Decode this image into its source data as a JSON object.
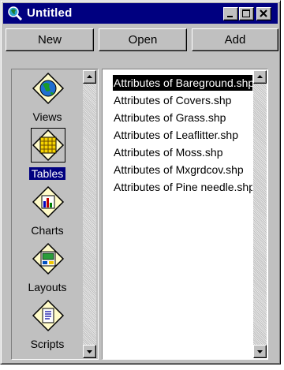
{
  "window": {
    "title": "Untitled"
  },
  "toolbar": {
    "new_label": "New",
    "open_label": "Open",
    "add_label": "Add"
  },
  "doc_types": [
    {
      "label": "Views",
      "icon": "globe-icon",
      "selected": false
    },
    {
      "label": "Tables",
      "icon": "table-grid-icon",
      "selected": true
    },
    {
      "label": "Charts",
      "icon": "bar-chart-icon",
      "selected": false
    },
    {
      "label": "Layouts",
      "icon": "layout-icon",
      "selected": false
    },
    {
      "label": "Scripts",
      "icon": "script-icon",
      "selected": false
    }
  ],
  "tables": [
    {
      "label": "Attributes of Bareground.shp",
      "selected": true
    },
    {
      "label": "Attributes of Covers.shp",
      "selected": false
    },
    {
      "label": "Attributes of Grass.shp",
      "selected": false
    },
    {
      "label": "Attributes of Leaflitter.shp",
      "selected": false
    },
    {
      "label": "Attributes of Moss.shp",
      "selected": false
    },
    {
      "label": "Attributes of Mxgrdcov.shp",
      "selected": false
    },
    {
      "label": "Attributes of Pine needle.shp",
      "selected": false
    }
  ],
  "colors": {
    "titlebar": "#000080",
    "face": "#c0c0c0",
    "selection_left": "#000080",
    "selection_right": "#000000"
  }
}
